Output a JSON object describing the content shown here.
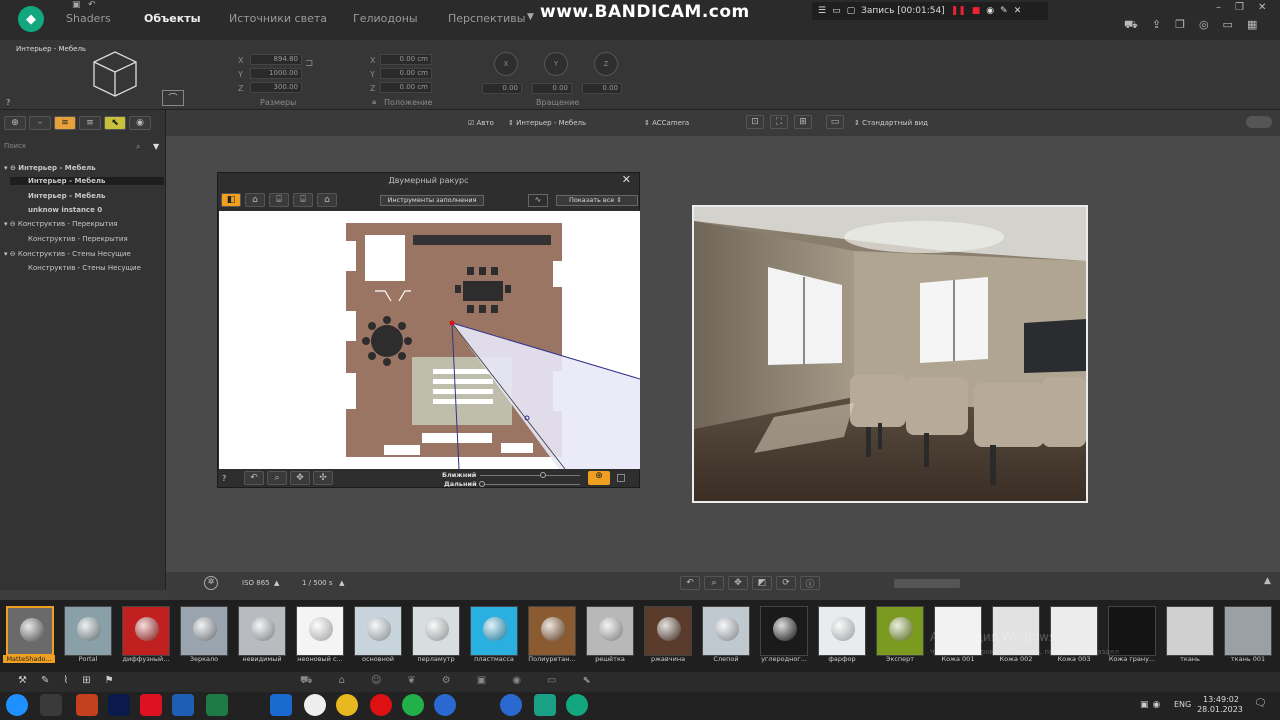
{
  "app": {
    "tabs": [
      "Shaders",
      "Объекты",
      "Источники света",
      "Гелиодоны",
      "Перспективы"
    ],
    "active_tab": "Объекты"
  },
  "recorder": {
    "brand": "www.BANDICAM.com",
    "recording_label": "Запись [00:01:54]"
  },
  "properties": {
    "object_name": "Интерьер - Мебель",
    "help": "?",
    "size": {
      "x": "894.80",
      "y": "1000.00",
      "z": "300.00",
      "caption": "Размеры"
    },
    "position": {
      "x": "0.00 cm",
      "y": "0.00 cm",
      "z": "0.00 cm",
      "caption": "Положение"
    },
    "rotation": {
      "x_label": "X",
      "y_label": "Y",
      "z_label": "Z",
      "x": "0.00",
      "y": "0.00",
      "z": "0.00",
      "caption": "Вращение"
    },
    "axis_labels": [
      "X",
      "Y",
      "Z"
    ]
  },
  "left_panel": {
    "search_placeholder": "Поиск",
    "tree": [
      {
        "label": "Интерьер - Мебель",
        "bold": true,
        "group": true
      },
      {
        "label": "Интерьер - Мебель",
        "bold": true,
        "selected": true
      },
      {
        "label": "Интерьер - Мебель",
        "bold": true
      },
      {
        "label": "unknow instance 0",
        "bold": true
      },
      {
        "label": "Конструктив - Перекрытия",
        "group": true
      },
      {
        "label": "Конструктив - Перекрытия"
      },
      {
        "label": "Конструктив - Стены Несущие",
        "group": true
      },
      {
        "label": "Конструктив - Стены Несущие"
      }
    ]
  },
  "view_bar": {
    "auto_label": "Авто",
    "object_select": "Интерьер - Мебель",
    "camera_select": "ACCamera",
    "view_select": "Стандартный вид"
  },
  "dialog": {
    "title": "Двумерный ракурс",
    "fill_tools": "Инструменты заполнения",
    "show_all": "Показать все",
    "near_label": "Ближний",
    "far_label": "Дальний",
    "help": "?"
  },
  "bottom_bar": {
    "iso": "ISO 865",
    "shutter": "1 / 500 s"
  },
  "materials": [
    "MatteShado...",
    "Portal",
    "диффузный...",
    "Зеркало",
    "невидимый",
    "неоновый с...",
    "основной",
    "перламутр",
    "пластмасса",
    "Полиуретан...",
    "решётка",
    "ржавчина",
    "Слепой",
    "углеродног...",
    "фарфор",
    "Эксперт",
    "Кожа 001",
    "Кожа 002",
    "Кожа 003",
    "Кожа грану...",
    "ткань",
    "ткань 001"
  ],
  "watermark": {
    "line1": "Активация Windows",
    "line2": "Чтобы активировать Windows, перейдите в раздел"
  },
  "taskbar": {
    "lang": "ENG",
    "time": "13:49:02",
    "date": "28.01.2023"
  }
}
